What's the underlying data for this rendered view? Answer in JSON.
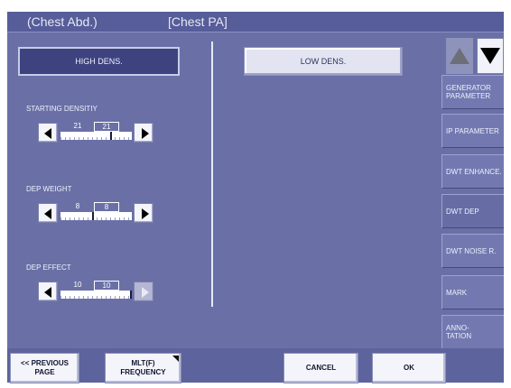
{
  "header": {
    "title_left": "(Chest Abd.)",
    "title_right": "[Chest PA]"
  },
  "modes": {
    "high": "HIGH DENS.",
    "low": "LOW DENS."
  },
  "params": [
    {
      "label": "STARTING DENSITIY",
      "value": "21",
      "box_value": "21",
      "level": 0.71,
      "right_enabled": true
    },
    {
      "label": "DEP WEIGHT",
      "value": "8",
      "box_value": "8",
      "level": 0.46,
      "right_enabled": true
    },
    {
      "label": "DEP EFFECT",
      "value": "10",
      "box_value": "10",
      "level": 1.0,
      "right_enabled": false
    }
  ],
  "sidebar": {
    "items": [
      {
        "label": "GENERATOR PARAMETER",
        "lines": [
          "GENERATOR",
          "PARAMETER"
        ],
        "active": false
      },
      {
        "label": "IP PARAMETER",
        "lines": [
          "IP PARAMETER"
        ],
        "active": false
      },
      {
        "label": "DWT ENHANCE.",
        "lines": [
          "DWT ENHANCE."
        ],
        "active": false
      },
      {
        "label": "DWT DEP",
        "lines": [
          "DWT DEP"
        ],
        "active": true
      },
      {
        "label": "DWT NOISE R.",
        "lines": [
          "DWT NOISE R."
        ],
        "active": false
      },
      {
        "label": "MARK",
        "lines": [
          "MARK"
        ],
        "active": false
      },
      {
        "label": "ANNO-TATION",
        "lines": [
          "ANNO-",
          "TATION"
        ],
        "active": false
      }
    ]
  },
  "footer": {
    "prev_lines": [
      "<< PREVIOUS",
      "PAGE"
    ],
    "mlt_lines": [
      "MLT(F)",
      "FREQUENCY"
    ],
    "cancel": "CANCEL",
    "ok": "OK"
  },
  "colors": {
    "panel": "#6a70a6",
    "header": "#565d99",
    "accent_dark": "#3e4380"
  }
}
